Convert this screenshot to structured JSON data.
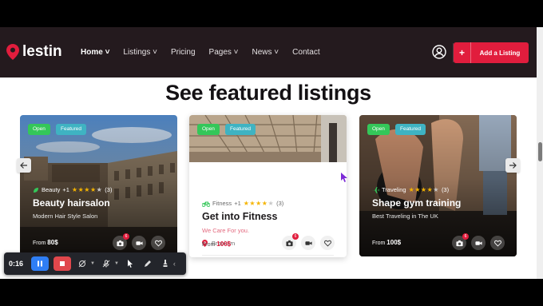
{
  "nav": {
    "logo_text": "lestin",
    "items": [
      {
        "label": "Home",
        "caret": true,
        "active": true
      },
      {
        "label": "Listings",
        "caret": true,
        "active": false
      },
      {
        "label": "Pricing",
        "caret": false,
        "active": false
      },
      {
        "label": "Pages",
        "caret": true,
        "active": false
      },
      {
        "label": "News",
        "caret": true,
        "active": false
      },
      {
        "label": "Contact",
        "caret": false,
        "active": false
      }
    ],
    "add_listing_label": "Add a Listing"
  },
  "section": {
    "heading": "See featured listings"
  },
  "cards": [
    {
      "badge_open": "Open",
      "badge_featured": "Featured",
      "category": "Beauty",
      "category_extra": "+1",
      "rating_count": "(3)",
      "stars": 4,
      "title": "Beauty hairsalon",
      "subtitle": "Modern Hair Style Salon",
      "price_prefix": "From",
      "price": "80$",
      "photo_count": "6"
    },
    {
      "badge_open": "Open",
      "badge_featured": "Featured",
      "category": "Fitness",
      "category_extra": "+1",
      "rating_count": "(3)",
      "stars": 4,
      "title": "Get into Fitness",
      "subtitle": "We Care For you.",
      "location": "Brooklyn",
      "price_prefix": "From",
      "price": "100$",
      "photo_count": "6"
    },
    {
      "badge_open": "Open",
      "badge_featured": "Featured",
      "category": "Traveling",
      "category_extra": "",
      "rating_count": "(3)",
      "stars": 4,
      "title": "Shape gym training",
      "subtitle": "Best Traveling in The UK",
      "price_prefix": "From",
      "price": "100$",
      "photo_count": "6"
    }
  ],
  "recorder": {
    "timer": "0:16"
  },
  "colors": {
    "brand_red": "#e11d3d",
    "nav_bg": "#241a1e",
    "open_badge": "#34c759",
    "featured_badge": "#3fb3c2",
    "star": "#f5b400"
  }
}
